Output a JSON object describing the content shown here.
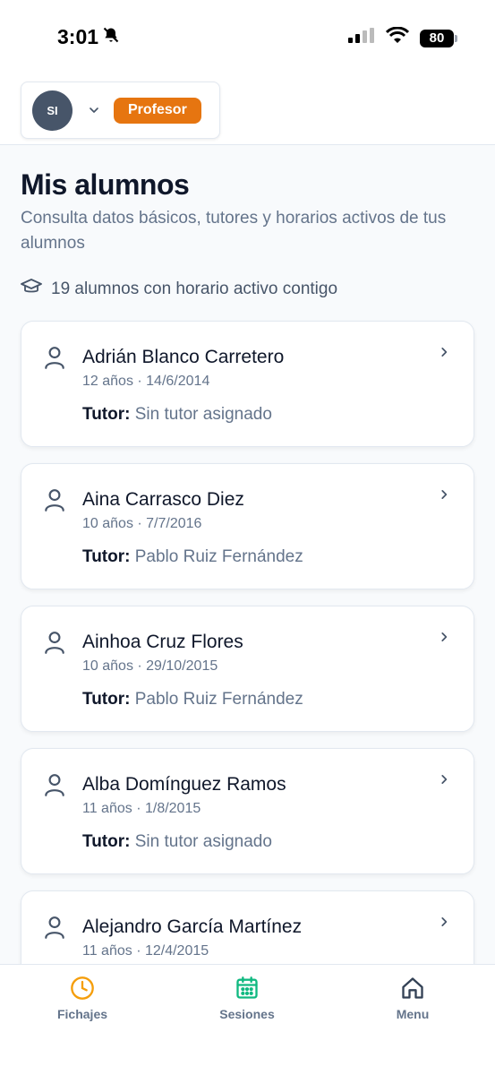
{
  "status_bar": {
    "time": "3:01",
    "battery": "80"
  },
  "header": {
    "avatar_initials": "SI",
    "role_badge": "Profesor"
  },
  "page": {
    "title": "Mis alumnos",
    "subtitle": "Consulta datos básicos, tutores y horarios activos de tus alumnos",
    "count_text": "19 alumnos con horario activo contigo"
  },
  "tutor_label": "Tutor:",
  "students": [
    {
      "name": "Adrián Blanco Carretero",
      "meta": "12 años · 14/6/2014",
      "tutor": "Sin tutor asignado"
    },
    {
      "name": "Aina Carrasco Diez",
      "meta": "10 años · 7/7/2016",
      "tutor": "Pablo Ruiz Fernández"
    },
    {
      "name": "Ainhoa Cruz Flores",
      "meta": "10 años · 29/10/2015",
      "tutor": "Pablo Ruiz Fernández"
    },
    {
      "name": "Alba Domínguez Ramos",
      "meta": "11 años · 1/8/2015",
      "tutor": "Sin tutor asignado"
    },
    {
      "name": "Alejandro García Martínez",
      "meta": "11 años · 12/4/2015",
      "tutor": ""
    }
  ],
  "bottom_nav": [
    {
      "label": "Fichajes",
      "icon": "clock-icon",
      "color": "#f59e0b"
    },
    {
      "label": "Sesiones",
      "icon": "calendar-icon",
      "color": "#10b981"
    },
    {
      "label": "Menu",
      "icon": "home-icon",
      "color": "#334155"
    }
  ],
  "colors": {
    "accent": "#e67510",
    "avatar_bg": "#475569",
    "text_muted": "#64748b"
  }
}
